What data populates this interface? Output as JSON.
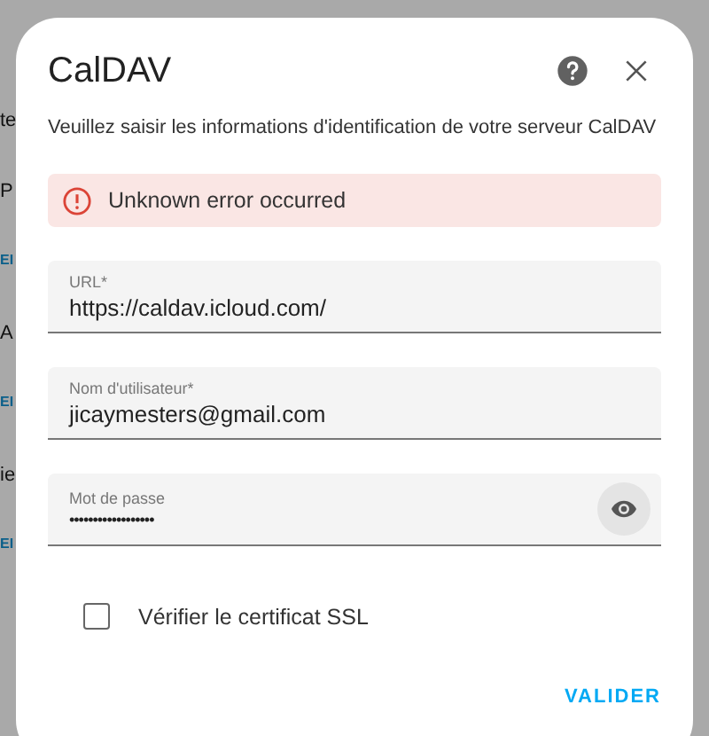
{
  "background": [
    {
      "text": "te",
      "kind": "text"
    },
    {
      "text": "P",
      "kind": "text"
    },
    {
      "text": "EI",
      "kind": "link"
    },
    {
      "text": "A",
      "kind": "text"
    },
    {
      "text": "EI",
      "kind": "link"
    },
    {
      "text": "ie",
      "kind": "text"
    },
    {
      "text": "EI",
      "kind": "link"
    }
  ],
  "dialog": {
    "title": "CalDAV",
    "description": "Veuillez saisir les informations d'identification de votre serveur CalDAV",
    "error": "Unknown error occurred",
    "fields": [
      {
        "label": "URL*",
        "value": "https://caldav.icloud.com/",
        "kind": "text"
      },
      {
        "label": "Nom d'utilisateur*",
        "value": "jicaymesters@gmail.com",
        "kind": "text"
      },
      {
        "label": "Mot de passe",
        "value": "••••••••••••••••••",
        "kind": "password"
      }
    ],
    "checkbox": {
      "label": "Vérifier le certificat SSL",
      "checked": false
    },
    "submit": "VALIDER"
  }
}
